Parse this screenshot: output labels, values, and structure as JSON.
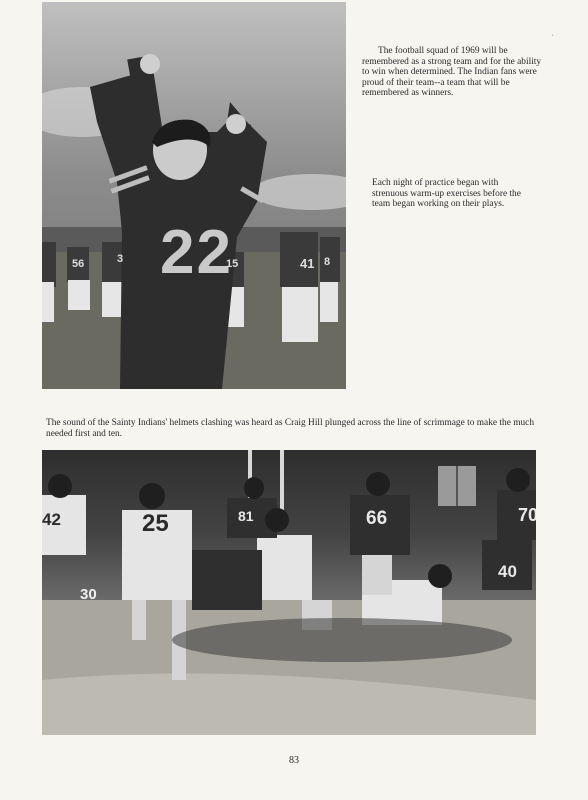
{
  "captions": {
    "intro": "The football squad of 1969 will be remembered as a strong team and for the ability to win when determined. The Indian fans were proud of their team--a team that will be remembered as winners.",
    "practice": "Each night of practice began with strenuous warm-up exercises before the team began working on their plays.",
    "game": "The sound of the Sainty Indians' helmets clashing was heard as Craig Hill plunged across the line of scrimmage to make the much needed first and ten."
  },
  "photo_top": {
    "jersey_main": "22",
    "jerseys_background": [
      "56",
      "3",
      "15",
      "41",
      "8"
    ]
  },
  "photo_bottom": {
    "jerseys": [
      "42",
      "25",
      "81",
      "66",
      "70",
      "40"
    ],
    "yard_marker": "30"
  },
  "page": {
    "number": "83",
    "corner_mark": "'"
  },
  "colors": {
    "paper": "#f6f5f0",
    "ink": "#2a2a2a"
  }
}
